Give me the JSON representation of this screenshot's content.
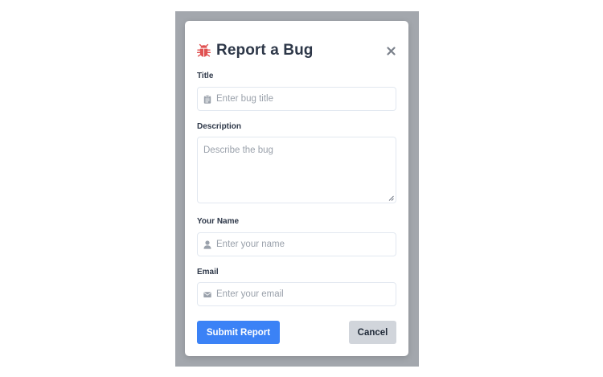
{
  "modal": {
    "title": "Report a Bug",
    "title_icon": "bug-icon",
    "close_icon": "close-icon"
  },
  "form": {
    "title_field": {
      "label": "Title",
      "placeholder": "Enter bug title",
      "icon": "clipboard-icon"
    },
    "description_field": {
      "label": "Description",
      "placeholder": "Describe the bug"
    },
    "name_field": {
      "label": "Your Name",
      "placeholder": "Enter your name",
      "icon": "user-icon"
    },
    "email_field": {
      "label": "Email",
      "placeholder": "Enter your email",
      "icon": "envelope-icon"
    }
  },
  "actions": {
    "submit_label": "Submit Report",
    "cancel_label": "Cancel"
  },
  "colors": {
    "accent": "#3b82f6",
    "bug_icon": "#e05252",
    "backdrop": "#a3a7ad",
    "cancel_bg": "#d1d5db"
  }
}
